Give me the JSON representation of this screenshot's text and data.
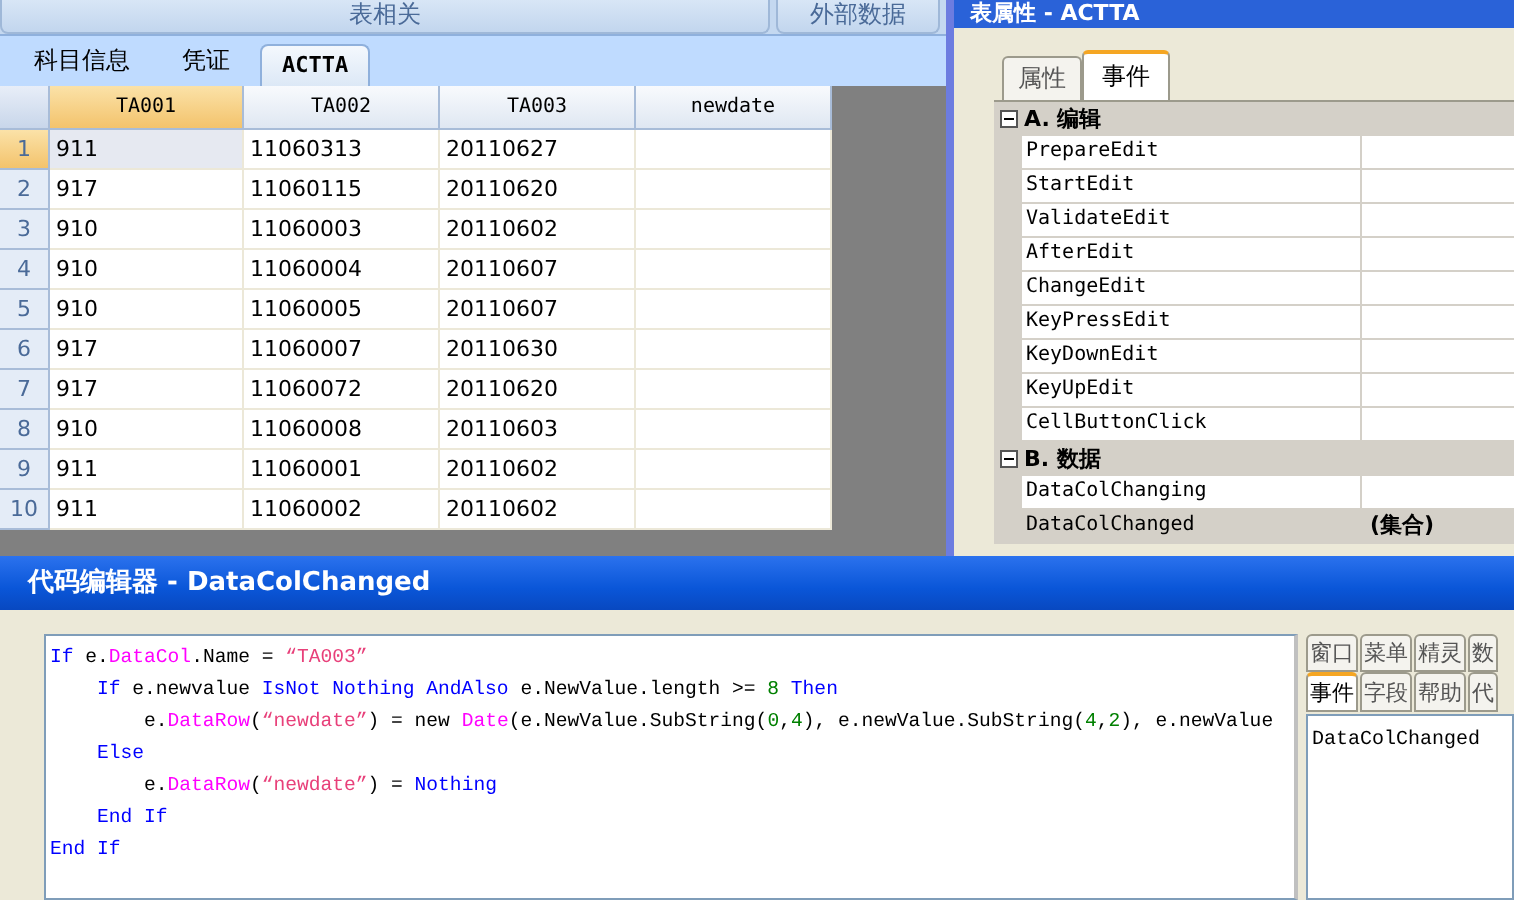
{
  "ribbon": {
    "groups": [
      "表相关",
      "外部数据"
    ]
  },
  "doc_tabs": [
    {
      "label": "科目信息",
      "selected": false
    },
    {
      "label": "凭证",
      "selected": false
    },
    {
      "label": "ACTTA",
      "selected": true
    }
  ],
  "table": {
    "columns": [
      {
        "label": "TA001",
        "selected": true
      },
      {
        "label": "TA002",
        "selected": false
      },
      {
        "label": "TA003",
        "selected": false
      },
      {
        "label": "newdate",
        "selected": false
      }
    ],
    "rows": [
      {
        "number": "1",
        "selected": true,
        "cells": [
          "911",
          "11060313",
          "20110627",
          ""
        ]
      },
      {
        "number": "2",
        "selected": false,
        "cells": [
          "917",
          "11060115",
          "20110620",
          ""
        ]
      },
      {
        "number": "3",
        "selected": false,
        "cells": [
          "910",
          "11060003",
          "20110602",
          ""
        ]
      },
      {
        "number": "4",
        "selected": false,
        "cells": [
          "910",
          "11060004",
          "20110607",
          ""
        ]
      },
      {
        "number": "5",
        "selected": false,
        "cells": [
          "910",
          "11060005",
          "20110607",
          ""
        ]
      },
      {
        "number": "6",
        "selected": false,
        "cells": [
          "917",
          "11060007",
          "20110630",
          ""
        ]
      },
      {
        "number": "7",
        "selected": false,
        "cells": [
          "917",
          "11060072",
          "20110620",
          ""
        ]
      },
      {
        "number": "8",
        "selected": false,
        "cells": [
          "910",
          "11060008",
          "20110603",
          ""
        ]
      },
      {
        "number": "9",
        "selected": false,
        "cells": [
          "911",
          "11060001",
          "20110602",
          ""
        ]
      },
      {
        "number": "10",
        "selected": false,
        "cells": [
          "911",
          "11060002",
          "20110602",
          ""
        ]
      }
    ]
  },
  "properties_window": {
    "title": "表属性 - ACTTA",
    "tabs": [
      {
        "label": "属性",
        "selected": false
      },
      {
        "label": "事件",
        "selected": true
      }
    ],
    "sections": [
      {
        "title": "A. 编辑",
        "expanded": true,
        "items": [
          {
            "name": "PrepareEdit",
            "selected": false
          },
          {
            "name": "StartEdit",
            "selected": false
          },
          {
            "name": "ValidateEdit",
            "selected": false
          },
          {
            "name": "AfterEdit",
            "selected": false
          },
          {
            "name": "ChangeEdit",
            "selected": false
          },
          {
            "name": "KeyPressEdit",
            "selected": false
          },
          {
            "name": "KeyDownEdit",
            "selected": false
          },
          {
            "name": "KeyUpEdit",
            "selected": false
          },
          {
            "name": "CellButtonClick",
            "selected": false
          }
        ]
      },
      {
        "title": "B. 数据",
        "expanded": true,
        "items": [
          {
            "name": "DataColChanging",
            "selected": false
          },
          {
            "name": "DataColChanged",
            "value": "(集合)",
            "selected": true
          }
        ]
      }
    ]
  },
  "code_editor": {
    "title": "代码编辑器 - DataColChanged",
    "lines": [
      {
        "tokens": [
          {
            "kind": "keyword",
            "text": "If"
          },
          {
            "kind": "plain",
            "text": " e."
          },
          {
            "kind": "member",
            "text": "DataCol"
          },
          {
            "kind": "plain",
            "text": ".Name = "
          },
          {
            "kind": "string",
            "text": "“TA003”"
          }
        ],
        "children": [
          {
            "tokens": [
              {
                "kind": "keyword",
                "text": "If"
              },
              {
                "kind": "plain",
                "text": " e.newvalue "
              },
              {
                "kind": "keyword",
                "text": "IsNot Nothing AndAlso"
              },
              {
                "kind": "plain",
                "text": " e.NewValue.length >= "
              },
              {
                "kind": "number",
                "text": "8"
              },
              {
                "kind": "keyword",
                "text": " Then"
              }
            ],
            "children": [
              {
                "tokens": [
                  {
                    "kind": "plain",
                    "text": "e."
                  },
                  {
                    "kind": "member",
                    "text": "DataRow"
                  },
                  {
                    "kind": "plain",
                    "text": "("
                  },
                  {
                    "kind": "string",
                    "text": "“newdate”"
                  },
                  {
                    "kind": "plain",
                    "text": ") = new "
                  },
                  {
                    "kind": "member",
                    "text": "Date"
                  },
                  {
                    "kind": "plain",
                    "text": "(e.NewValue.SubString("
                  },
                  {
                    "kind": "number",
                    "text": "0"
                  },
                  {
                    "kind": "plain",
                    "text": ","
                  },
                  {
                    "kind": "number",
                    "text": "4"
                  },
                  {
                    "kind": "plain",
                    "text": "), e.newValue.SubString("
                  },
                  {
                    "kind": "number",
                    "text": "4"
                  },
                  {
                    "kind": "plain",
                    "text": ","
                  },
                  {
                    "kind": "number",
                    "text": "2"
                  },
                  {
                    "kind": "plain",
                    "text": "), e.newValue"
                  }
                ]
              }
            ]
          },
          {
            "tokens": [
              {
                "kind": "keyword",
                "text": "Else"
              }
            ],
            "children": [
              {
                "tokens": [
                  {
                    "kind": "plain",
                    "text": "e."
                  },
                  {
                    "kind": "member",
                    "text": "DataRow"
                  },
                  {
                    "kind": "plain",
                    "text": "("
                  },
                  {
                    "kind": "string",
                    "text": "“newdate”"
                  },
                  {
                    "kind": "plain",
                    "text": ") = "
                  },
                  {
                    "kind": "keyword",
                    "text": "Nothing"
                  }
                ]
              }
            ]
          },
          {
            "tokens": [
              {
                "kind": "keyword",
                "text": "End If"
              }
            ]
          }
        ]
      },
      {
        "tokens": [
          {
            "kind": "keyword",
            "text": "End If"
          }
        ]
      }
    ],
    "side_tabs": [
      [
        {
          "label": "窗口",
          "selected": false
        },
        {
          "label": "菜单",
          "selected": false
        },
        {
          "label": "精灵",
          "selected": false
        },
        {
          "label": "数",
          "selected": false
        }
      ],
      [
        {
          "label": "事件",
          "selected": true
        },
        {
          "label": "字段",
          "selected": false
        },
        {
          "label": "帮助",
          "selected": false
        },
        {
          "label": "代",
          "selected": false
        }
      ]
    ],
    "event_list": [
      "DataColChanged"
    ]
  }
}
